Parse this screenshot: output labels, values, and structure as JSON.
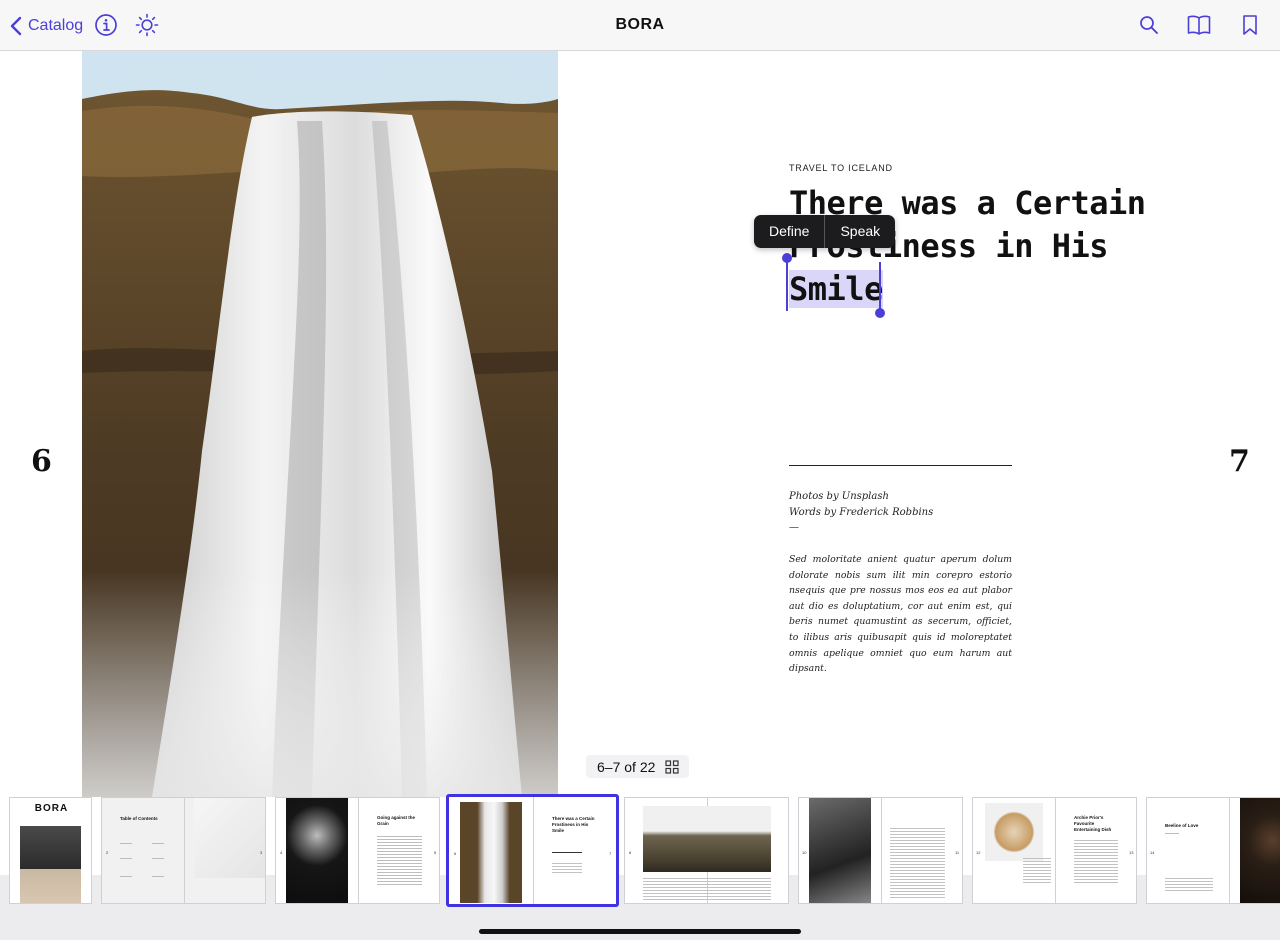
{
  "topbar": {
    "back_label": "Catalog",
    "title": "BORA",
    "icons": [
      "chevron-left-icon",
      "info-icon",
      "brightness-icon",
      "search-icon",
      "book-icon",
      "bookmark-icon"
    ],
    "accent_color": "#4b3fd8"
  },
  "spread": {
    "left_page_number": "6",
    "right_page_number": "7",
    "kicker": "TRAVEL TO ICELAND",
    "headline_line1": "There was a Certain",
    "headline_line2": "Frostiness in His",
    "headline_selected": "Smile",
    "credit_photos": "Photos by Unsplash",
    "credit_words": "Words by Frederick Robbins",
    "credit_dash": "—",
    "body": "Sed moloritate anient quatur aperum dolum dolorate nobis sum ilit min corepro estorio nsequis que pre nossus mos eos ea aut plabor aut dio es doluptatium, cor aut enim est, qui beris numet quamustint as secerum, officiet, to ilibus aris quibusapit quis id moloreptatet omnis apelique omniet quo eum harum aut dipsant."
  },
  "context_menu": {
    "define": "Define",
    "speak": "Speak"
  },
  "counter": {
    "label": "6–7 of 22"
  },
  "thumbnails": {
    "cover_title": "BORA",
    "toc_title": "Table of Contents",
    "page4_5_title": "Going against the Grain",
    "page6_7_title": "There was a Certain Frostiness in His Smile",
    "page12_13_title": "Archie Prior's Favourite Entertaining Dish",
    "page14_title": "Beeline of Love",
    "numbers": [
      "2",
      "3",
      "4",
      "5",
      "6",
      "7",
      "8",
      "10",
      "11",
      "12",
      "13",
      "14"
    ],
    "selected_color": "#3f32e0"
  }
}
